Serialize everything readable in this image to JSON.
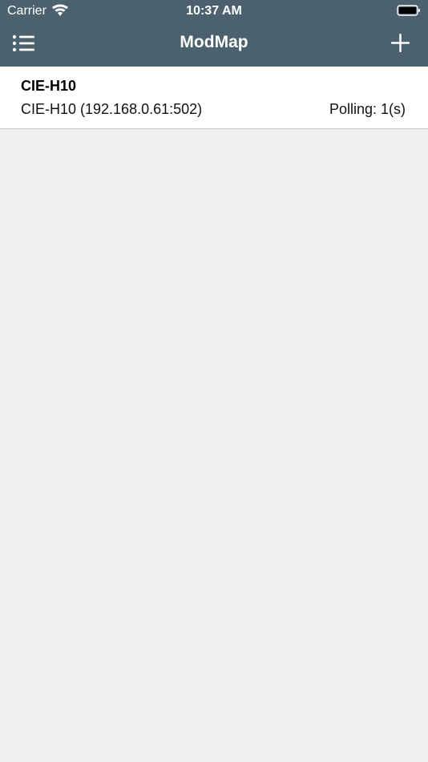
{
  "status_bar": {
    "carrier": "Carrier",
    "time": "10:37 AM",
    "wifi_icon": "wifi-icon",
    "battery_icon": "battery-icon"
  },
  "navigation": {
    "title": "ModMap",
    "menu_icon": "list-menu-icon",
    "add_icon": "plus-icon"
  },
  "connections": [
    {
      "name": "CIE-H10",
      "address": "CIE-H10 (192.168.0.61:502)",
      "polling": "Polling: 1(s)"
    }
  ],
  "colors": {
    "navbar": "#4b626e",
    "background": "#f0f0f0",
    "row_background": "#ffffff"
  }
}
